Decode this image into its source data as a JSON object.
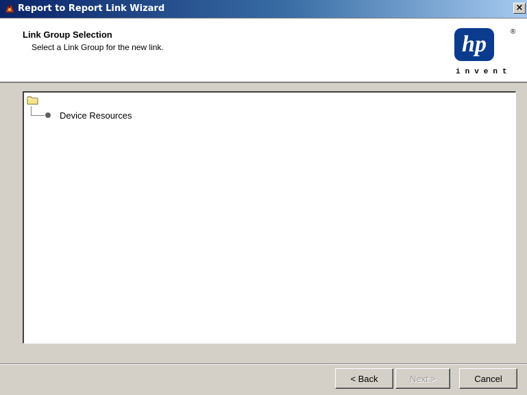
{
  "window": {
    "title": "Report to Report Link Wizard",
    "app_icon": "wizard-app-icon",
    "close_label": "×"
  },
  "header": {
    "title": "Link Group Selection",
    "subtitle": "Select a Link Group for the new link.",
    "logo": {
      "mark": "hp",
      "registered": "®",
      "tagline": "invent"
    }
  },
  "tree": {
    "root_icon": "folder-icon",
    "nodes": [
      {
        "label": "Device Resources",
        "icon": "bullet-node-icon"
      }
    ]
  },
  "buttons": {
    "back": "< Back",
    "next": "Next >",
    "next_enabled": false,
    "cancel": "Cancel"
  }
}
